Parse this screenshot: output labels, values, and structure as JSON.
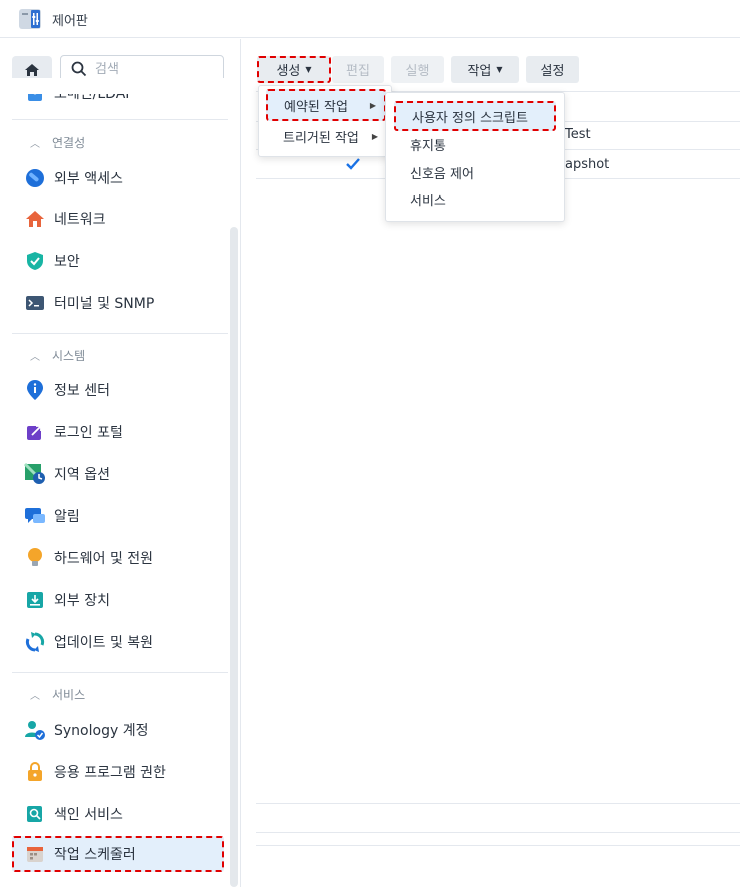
{
  "window": {
    "title": "제어판",
    "icon": "control-panel-icon"
  },
  "sidebar": {
    "search_placeholder": "검색",
    "partial_item": "도메인/LDAP",
    "sections": [
      {
        "label": "연결성",
        "items": [
          {
            "label": "외부 액세스",
            "icon": "external-access-icon"
          },
          {
            "label": "네트워크",
            "icon": "network-icon"
          },
          {
            "label": "보안",
            "icon": "shield-icon"
          },
          {
            "label": "터미널 및 SNMP",
            "icon": "terminal-icon"
          }
        ]
      },
      {
        "label": "시스템",
        "items": [
          {
            "label": "정보 센터",
            "icon": "info-icon"
          },
          {
            "label": "로그인 포털",
            "icon": "login-portal-icon"
          },
          {
            "label": "지역 옵션",
            "icon": "regional-options-icon"
          },
          {
            "label": "알림",
            "icon": "notification-icon"
          },
          {
            "label": "하드웨어 및 전원",
            "icon": "hardware-power-icon"
          },
          {
            "label": "외부 장치",
            "icon": "external-device-icon"
          },
          {
            "label": "업데이트 및 복원",
            "icon": "update-restore-icon"
          }
        ]
      },
      {
        "label": "서비스",
        "items": [
          {
            "label": "Synology 계정",
            "icon": "synology-account-icon"
          },
          {
            "label": "응용 프로그램 권한",
            "icon": "app-privileges-icon"
          },
          {
            "label": "색인 서비스",
            "icon": "indexing-service-icon"
          },
          {
            "label": "작업 스케줄러",
            "icon": "task-scheduler-icon",
            "active": true
          }
        ]
      }
    ]
  },
  "toolbar": {
    "create": "생성",
    "edit": "편집",
    "run": "실행",
    "action": "작업",
    "settings": "설정"
  },
  "table": {
    "row1_partial": "Test",
    "row2_partial": "apshot",
    "row2_checked": true
  },
  "menu": {
    "scheduled_task": "예약된 작업",
    "triggered_task": "트리거된 작업"
  },
  "submenu": {
    "user_script": "사용자 정의 스크립트",
    "recycle_bin": "휴지통",
    "beep_control": "신호음 제어",
    "service": "서비스"
  },
  "colors": {
    "accent": "#1a73e8",
    "highlight": "#e10000",
    "active_bg": "#e3effb"
  }
}
